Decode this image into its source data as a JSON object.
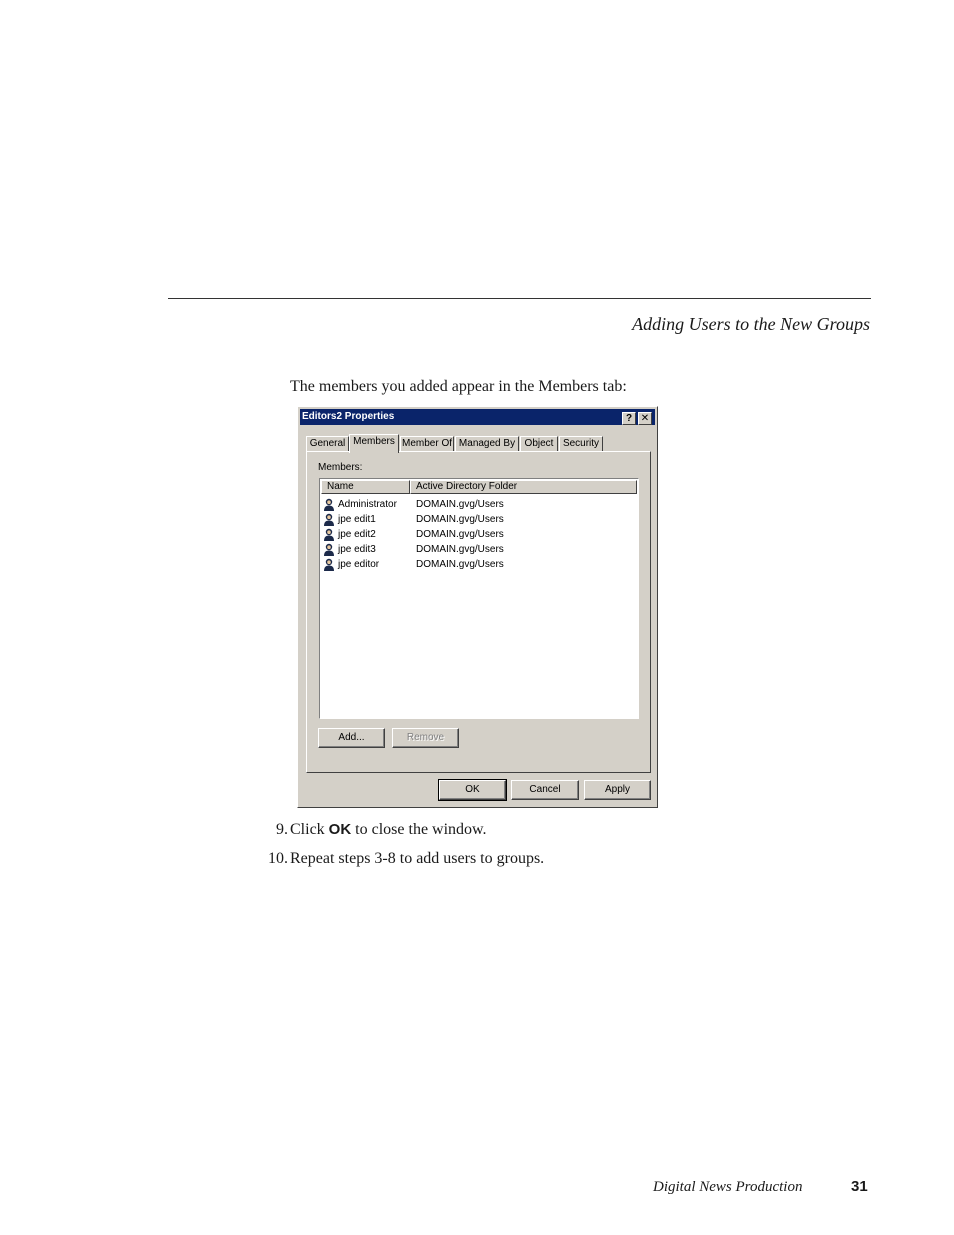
{
  "header": {
    "section_title": "Adding Users to the New Groups"
  },
  "intro_text": "The members you added appear in the Members tab:",
  "dialog": {
    "title": "Editors2 Properties",
    "help_glyph": "?",
    "close_glyph": "✕",
    "tabs": [
      {
        "label": "General"
      },
      {
        "label": "Members"
      },
      {
        "label": "Member Of"
      },
      {
        "label": "Managed By"
      },
      {
        "label": "Object"
      },
      {
        "label": "Security"
      }
    ],
    "active_tab": "Members",
    "members_label": "Members:",
    "columns": {
      "name": "Name",
      "folder": "Active Directory Folder"
    },
    "members": [
      {
        "name": "Administrator",
        "folder": "DOMAIN.gvg/Users"
      },
      {
        "name": "jpe edit1",
        "folder": "DOMAIN.gvg/Users"
      },
      {
        "name": "jpe edit2",
        "folder": "DOMAIN.gvg/Users"
      },
      {
        "name": "jpe edit3",
        "folder": "DOMAIN.gvg/Users"
      },
      {
        "name": "jpe editor",
        "folder": "DOMAIN.gvg/Users"
      }
    ],
    "buttons": {
      "add": "Add...",
      "remove": "Remove",
      "ok": "OK",
      "cancel": "Cancel",
      "apply": "Apply"
    }
  },
  "steps": [
    {
      "number": "9.",
      "before": "Click ",
      "bold": "OK",
      "after": " to close the window."
    },
    {
      "number": "10.",
      "text": "Repeat steps 3-8 to add users to groups."
    }
  ],
  "footer": {
    "doc_title": "Digital News Production",
    "page_number": "31"
  }
}
